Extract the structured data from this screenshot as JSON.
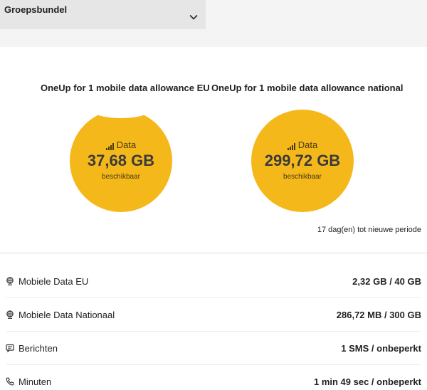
{
  "bundle_select": {
    "label": "Groepsbundel"
  },
  "bundles": [
    {
      "title": "OneUp for 1 mobile data allowance EU",
      "kind": "Data",
      "amount": "37,68 GB",
      "status": "beschikbaar",
      "remaining_fraction": 0.94
    },
    {
      "title": "OneUp for 1 mobile data allowance national",
      "kind": "Data",
      "amount": "299,72 GB",
      "status": "beschikbaar",
      "remaining_fraction": 1.0
    }
  ],
  "period_text": "17 dag(en) tot nieuwe periode",
  "usage": [
    {
      "icon": "globe-icon",
      "label": "Mobiele Data EU",
      "value": "2,32 GB / 40 GB"
    },
    {
      "icon": "globe-icon",
      "label": "Mobiele Data Nationaal",
      "value": "286,72 MB / 300 GB"
    },
    {
      "icon": "message-icon",
      "label": "Berichten",
      "value": "1 SMS / onbeperkt"
    },
    {
      "icon": "phone-icon",
      "label": "Minuten",
      "value": "1 min 49 sec / onbeperkt"
    }
  ],
  "colors": {
    "accent": "#f5b81b",
    "background": "#f4f4f4",
    "card": "#ffffff"
  }
}
